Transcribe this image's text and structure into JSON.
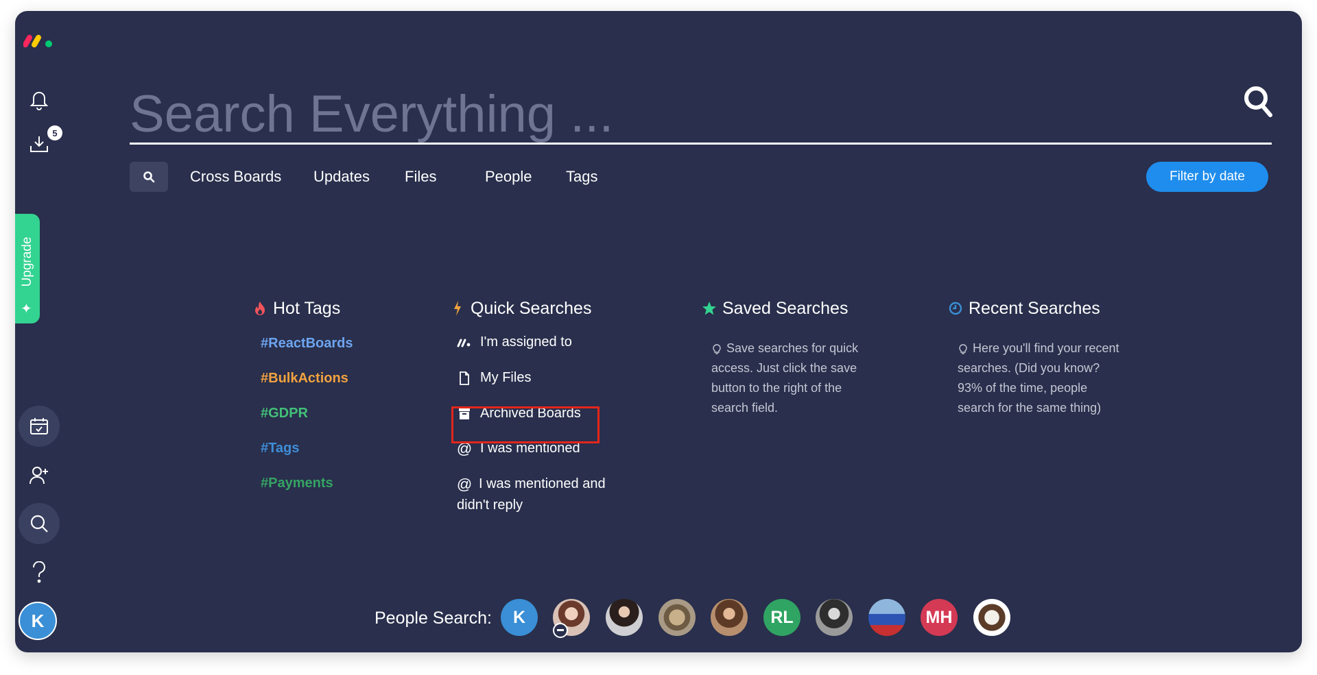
{
  "sidebar": {
    "notification_badge": "5",
    "upgrade_label": "Upgrade",
    "user_initial": "K"
  },
  "search": {
    "placeholder": "Search Everything ..."
  },
  "tabs": {
    "cross_boards": "Cross Boards",
    "updates": "Updates",
    "files": "Files",
    "people": "People",
    "tags": "Tags",
    "filter_by_date": "Filter by date"
  },
  "hot_tags": {
    "title": "Hot Tags",
    "items": [
      {
        "label": "#ReactBoards",
        "color": "#6ea5f0"
      },
      {
        "label": "#BulkActions",
        "color": "#f2a240"
      },
      {
        "label": "#GDPR",
        "color": "#42c179"
      },
      {
        "label": "#Tags",
        "color": "#3f8ed8"
      },
      {
        "label": "#Payments",
        "color": "#35a464"
      }
    ]
  },
  "quick_searches": {
    "title": "Quick Searches",
    "items": [
      {
        "label": "I'm assigned to",
        "icon": "monday-logo-icon"
      },
      {
        "label": "My Files",
        "icon": "file-icon"
      },
      {
        "label": "Archived Boards",
        "icon": "archive-icon"
      },
      {
        "label": "I was mentioned",
        "icon": "at-icon"
      },
      {
        "label": "I was mentioned and didn't reply",
        "icon": "at-icon"
      }
    ]
  },
  "saved_searches": {
    "title": "Saved Searches",
    "hint": "Save searches for quick access. Just click the save button to the right of the search field."
  },
  "recent_searches": {
    "title": "Recent Searches",
    "hint": "Here you'll find your recent searches. (Did you know? 93% of the time, people search for the same thing)"
  },
  "people_search": {
    "label": "People Search:",
    "people": [
      {
        "initials": "K",
        "color": "#3a8fd6"
      },
      {
        "initials": "",
        "color": ""
      },
      {
        "initials": "",
        "color": ""
      },
      {
        "initials": "",
        "color": ""
      },
      {
        "initials": "",
        "color": ""
      },
      {
        "initials": "RL",
        "color": "#30a463"
      },
      {
        "initials": "",
        "color": ""
      },
      {
        "initials": "",
        "color": ""
      },
      {
        "initials": "MH",
        "color": "#d53a55"
      },
      {
        "initials": "",
        "color": ""
      }
    ]
  },
  "colors": {
    "background": "#292f4c",
    "accent": "#1f8ded",
    "upgrade": "#33d391",
    "highlight": "#e4261b"
  }
}
